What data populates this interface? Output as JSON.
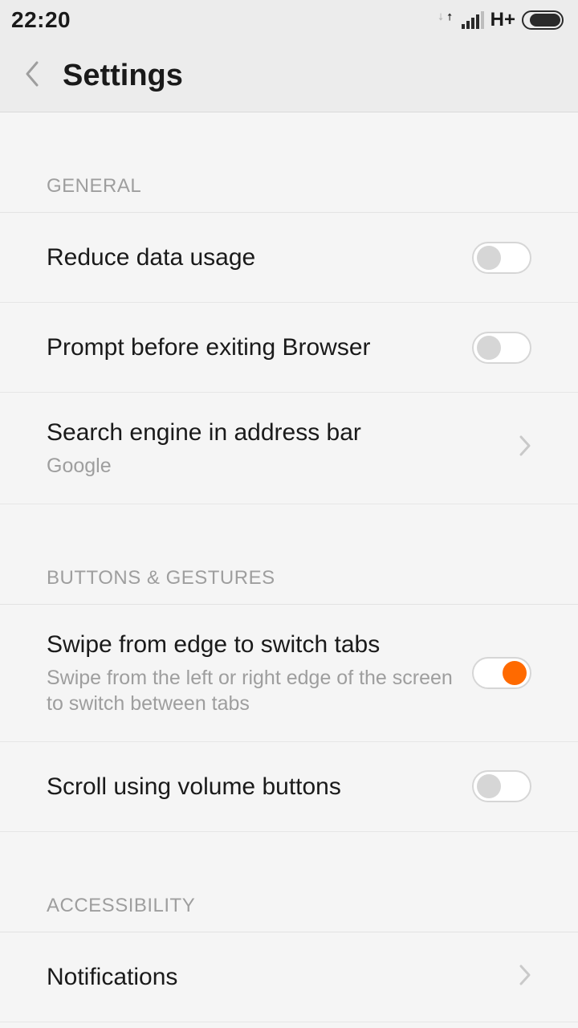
{
  "status": {
    "time": "22:20",
    "network": "H+"
  },
  "header": {
    "title": "Settings"
  },
  "sections": {
    "general": {
      "label": "GENERAL",
      "reduce_data": {
        "title": "Reduce data usage",
        "on": false
      },
      "prompt_exit": {
        "title": "Prompt before exiting Browser",
        "on": false
      },
      "search_engine": {
        "title": "Search engine in address bar",
        "value": "Google"
      }
    },
    "buttons": {
      "label": "BUTTONS & GESTURES",
      "swipe_tabs": {
        "title": "Swipe from edge to switch tabs",
        "sub": "Swipe from the left or right edge of the screen to switch between tabs",
        "on": true
      },
      "scroll_volume": {
        "title": "Scroll using volume buttons",
        "on": false
      }
    },
    "accessibility": {
      "label": "ACCESSIBILITY",
      "notifications": {
        "title": "Notifications"
      }
    }
  }
}
